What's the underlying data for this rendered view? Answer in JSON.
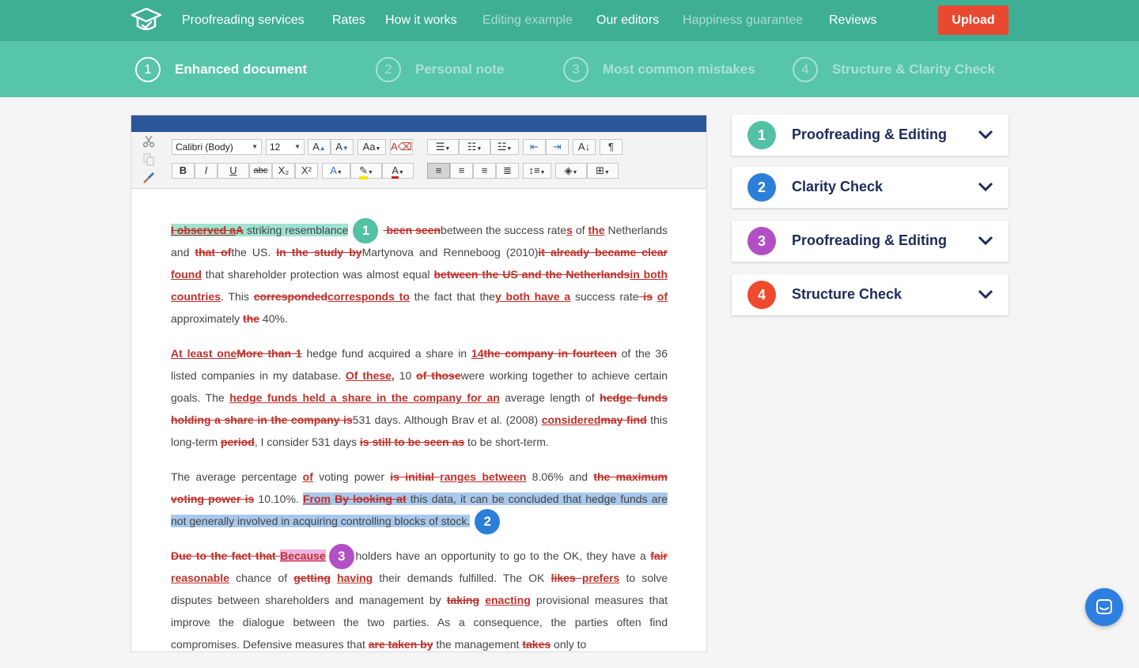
{
  "nav": {
    "links": [
      "Proofreading services",
      "Rates",
      "How it works",
      "Editing example",
      "Our editors",
      "Happiness guarantee",
      "Reviews"
    ],
    "upload": "Upload"
  },
  "steps": [
    {
      "num": "1",
      "label": "Enhanced document"
    },
    {
      "num": "2",
      "label": "Personal note"
    },
    {
      "num": "3",
      "label": "Most common mistakes"
    },
    {
      "num": "4",
      "label": "Structure & Clarity Check"
    }
  ],
  "toolbar": {
    "font": "Calibri (Body)",
    "size": "12",
    "bold": "B",
    "italic": "I",
    "underline": "U",
    "strike": "abc",
    "subscript": "X₂",
    "superscript": "X²",
    "pilcrow": "¶"
  },
  "doc": {
    "p1": {
      "s1_del": "I observed a",
      "s1_ins": "A",
      "s2": " striking resemblance",
      "m1": "1",
      "s3_del": " been seen",
      "s4": "between the success rate",
      "s5_ins": "s",
      "s6": " of ",
      "s7_ins": "the",
      "s8": " Netherlands and ",
      "s9_del": "that of",
      "s10": "the US. ",
      "s11_del": "In the study by",
      "s12": "Martynova and Renneboog (2010)",
      "s13_del": "it already became clear",
      "s14": " ",
      "s15_ins": "found",
      "s16": " that shareholder protection was almost equal ",
      "s17_del": "between the US and the Netherlands",
      "s18_ins": "in both countries",
      "s19": ". This ",
      "s20_del": "corresponded",
      "s21_ins": "corresponds to",
      "s22": " the fact that the",
      "s23_ins": "y both have a",
      "s24": " success rate",
      "s25_del": " is",
      "s26": " ",
      "s27_ins": "of",
      "s28": " approximately ",
      "s29_del": "the",
      "s30": " 40%."
    },
    "p2": {
      "s1_ins": "At least one",
      "s2_del": "More than 1",
      "s3": " hedge fund acquired a share in ",
      "s4_ins": "14",
      "s5_del": "the company in fourteen",
      "s6": " of the 36 listed companies in my database. ",
      "s7_ins": "Of these,",
      "s8": " 10 ",
      "s9_del": "of those",
      "s10": "were working together to achieve certain goals. The ",
      "s11_ins": "hedge funds held a share in the company for an",
      "s12": " average length of ",
      "s13_del": "hedge funds holding a share in the company is",
      "s14": "531 days. Although Brav et al. (2008) ",
      "s15_ins": "considered",
      "s16_del": "may find",
      "s17": " this long-term ",
      "s18_del": "period",
      "s19": ", I consider 531 days ",
      "s20_del": "is still to be seen as",
      "s21": " to be short-term."
    },
    "p3": {
      "s1": "The average percentage ",
      "s2_ins": "of",
      "s3": " voting power ",
      "s4_del": "is initial ",
      "s5_ins": "ranges between",
      "s6": " 8.06% and ",
      "s7_del": "the maximum voting power is",
      "s8": " 10.10%. ",
      "s9_ins": "From",
      "s10": " ",
      "s11_del": "By looking at",
      "s12": " this data, it can be concluded that hedge funds are not generally involved in acquiring controlling blocks of stock.",
      "m2": "2"
    },
    "p4": {
      "s1_del": "Due to the fact that ",
      "s2_ins": "Because",
      "m3": "3",
      "s3": "eholders have an opportunity to go to the OK, they have a ",
      "s4_del": "fair",
      "s5": " ",
      "s6_ins": "reasonable",
      "s7": " chance of ",
      "s8_del": "getting",
      "s9": " ",
      "s10_ins": "having",
      "s11": " their demands fulfilled. The OK ",
      "s12_del": "likes ",
      "s13_ins": "prefers",
      "s14": " to solve disputes between shareholders and management by ",
      "s15_del": "taking",
      "s16": " ",
      "s17_ins": "enacting",
      "s18": " provisional measures that improve the dialogue between the two parties. As a consequence, the parties often find compromises. Defensive measures that ",
      "s19_del": "are taken by",
      "s20": " the management ",
      "s21_del": "takes",
      "s22": " only to"
    }
  },
  "cards": [
    {
      "num": "1",
      "title": "Proofreading & Editing",
      "color": "#53c1a4"
    },
    {
      "num": "2",
      "title": "Clarity Check",
      "color": "#2c7fd9"
    },
    {
      "num": "3",
      "title": "Proofreading & Editing",
      "color": "#b24fc5"
    },
    {
      "num": "4",
      "title": "Structure Check",
      "color": "#ee4a2e"
    }
  ],
  "colors": {
    "nav_bg": "#3faf93",
    "steps_bg": "#56c5a9",
    "upload": "#e9492f",
    "edit_red": "#c0302a",
    "doc_titlebar": "#2b579a"
  },
  "icons": [
    "logo-icon",
    "cut-icon",
    "copy-icon",
    "format-painter-icon",
    "chevron-down-icon",
    "chat-icon"
  ]
}
